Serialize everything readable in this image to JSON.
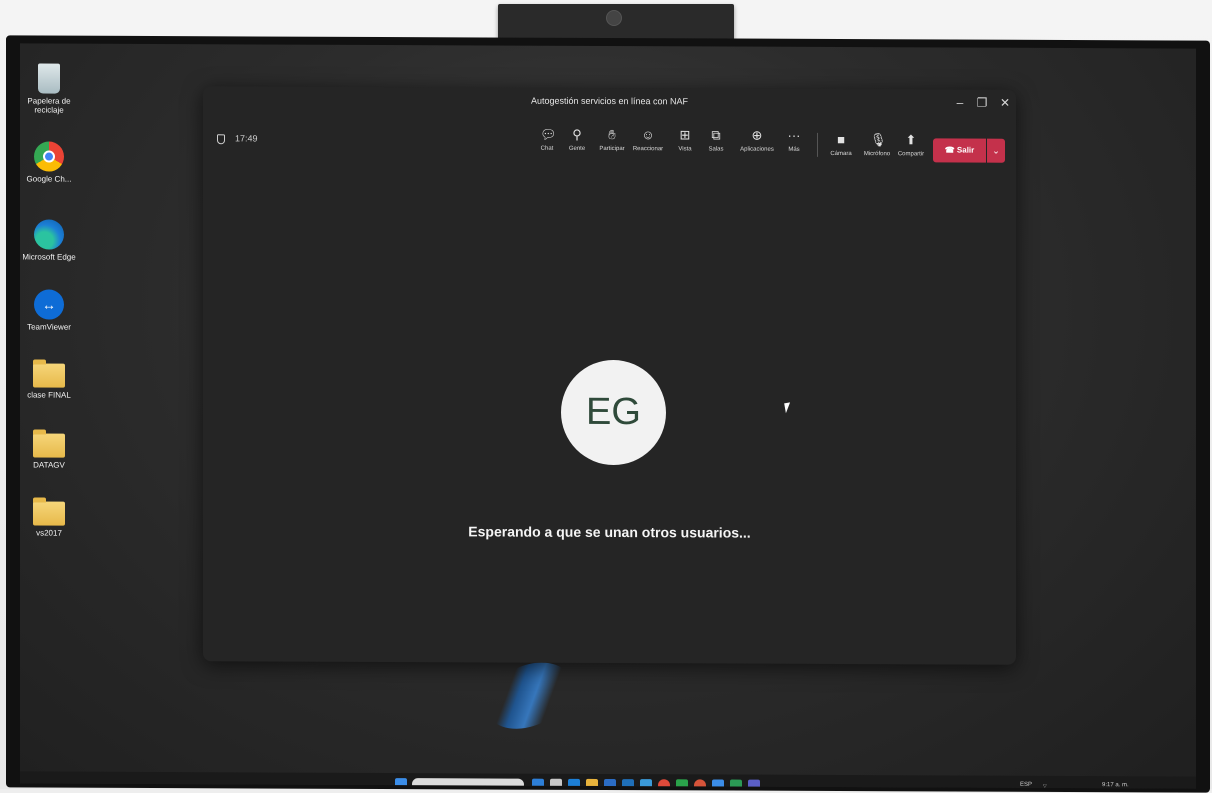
{
  "desktop": {
    "icons": [
      {
        "label": "Papelera de reciclaje",
        "icon": "recycle-bin-icon"
      },
      {
        "label": "Google Ch...",
        "icon": "chrome-icon"
      },
      {
        "label": "Microsoft Edge",
        "icon": "edge-icon"
      },
      {
        "label": "TeamViewer",
        "icon": "teamviewer-icon"
      },
      {
        "label": "clase FINAL",
        "icon": "folder-icon"
      },
      {
        "label": "DATAGV",
        "icon": "folder-icon"
      },
      {
        "label": "vs2017",
        "icon": "folder-icon"
      }
    ]
  },
  "meeting": {
    "title": "Autogestión servicios en línea con NAF",
    "elapsed": "17:49",
    "avatar_initials": "EG",
    "waiting_message": "Esperando a que se unan otros usuarios...",
    "toolbar": [
      {
        "label": "Chat",
        "icon": "chat-icon"
      },
      {
        "label": "Gente",
        "icon": "people-icon"
      },
      {
        "label": "Participar",
        "icon": "raise-hand-icon"
      },
      {
        "label": "Reaccionar",
        "icon": "emoji-icon"
      },
      {
        "label": "Vista",
        "icon": "view-icon"
      },
      {
        "label": "Salas",
        "icon": "rooms-icon"
      },
      {
        "label": "Aplicaciones",
        "icon": "apps-icon"
      },
      {
        "label": "Más",
        "icon": "more-icon"
      }
    ],
    "media": [
      {
        "label": "Cámara",
        "icon": "camera-icon"
      },
      {
        "label": "Micrófono",
        "icon": "mic-muted-icon"
      },
      {
        "label": "Compartir",
        "icon": "share-icon"
      }
    ],
    "leave_label": "Salir",
    "accent_leave": "#c4314b"
  },
  "taskbar": {
    "language": "ESP",
    "time": "9:17 a. m."
  }
}
